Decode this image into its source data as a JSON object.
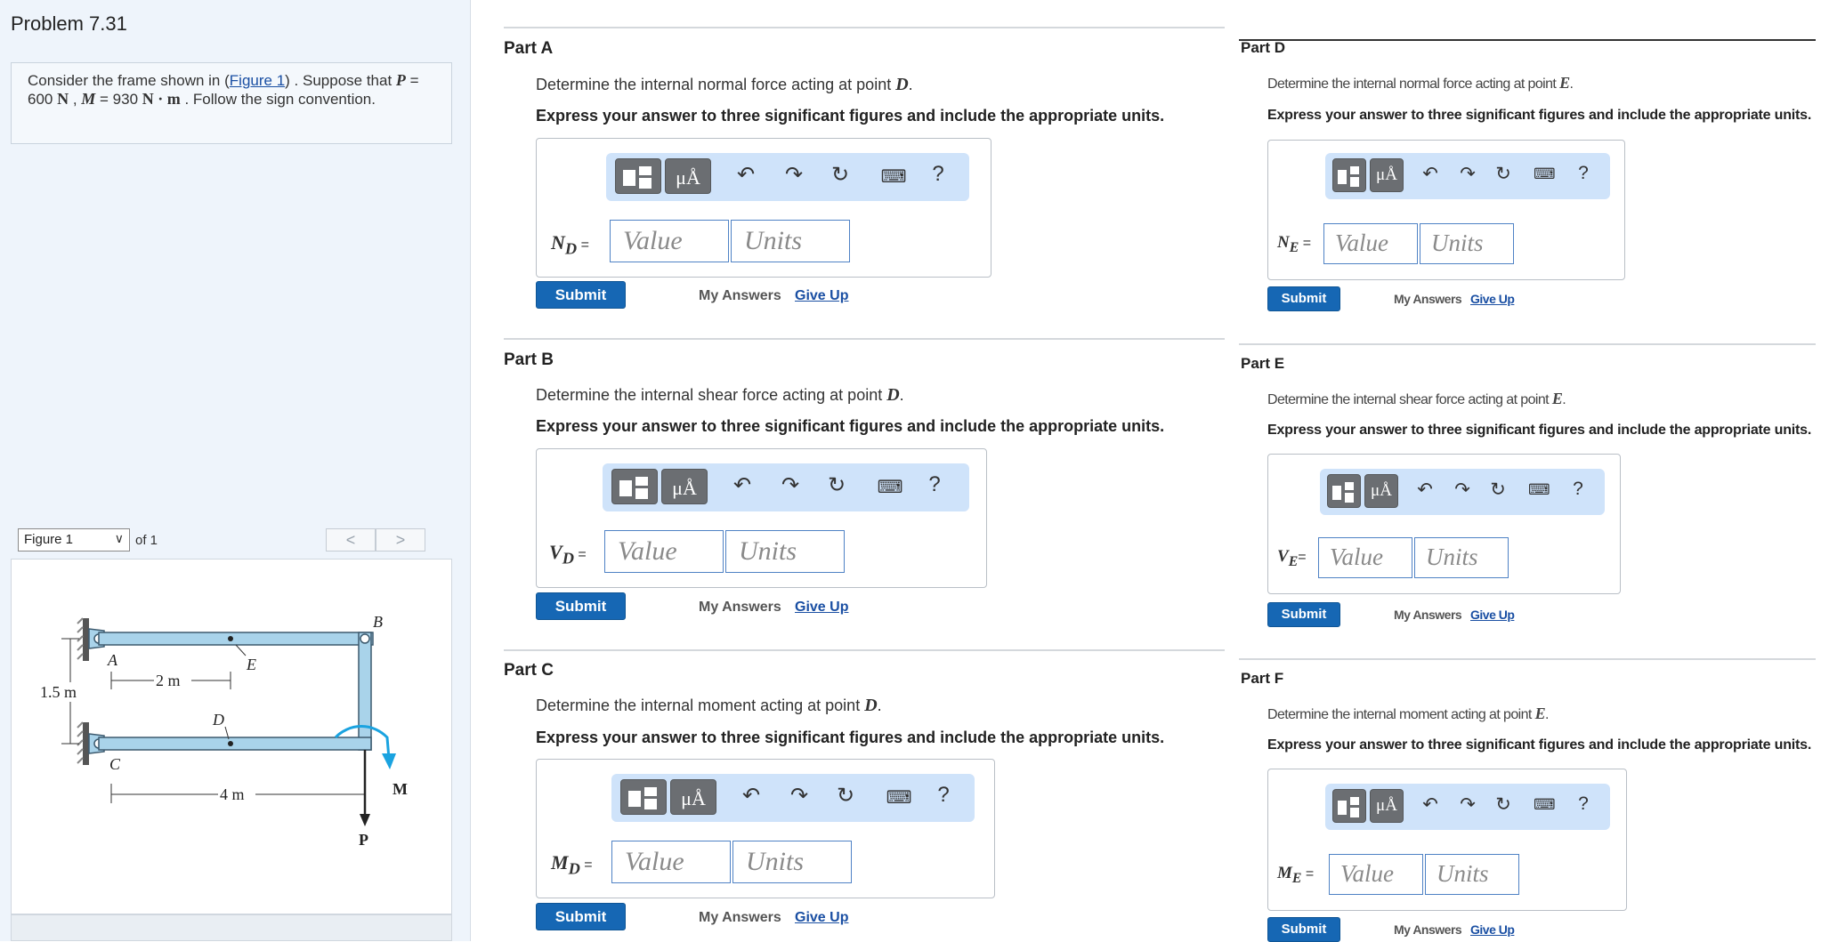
{
  "problem": {
    "title": "Problem 7.31",
    "intro": {
      "pre": "Consider the frame shown in (",
      "link": "Figure 1",
      "mid": ") . Suppose that",
      "p_var": "P",
      "p_val": " = 600  ",
      "p_unit": "N",
      "sep": " , ",
      "m_var": "M",
      "m_val": " = 930  ",
      "m_unit": "N · m",
      "post": " . Follow the sign convention."
    }
  },
  "figure": {
    "selector_value": "Figure 1",
    "of_label": "of 1",
    "prev": "<",
    "next": ">",
    "labels": {
      "A": "A",
      "B": "B",
      "C": "C",
      "D": "D",
      "E": "E",
      "M": "M",
      "P": "P",
      "dim_2m": "2 m",
      "dim_4m": "4 m",
      "dim_15m": "1.5 m"
    }
  },
  "common": {
    "instruction": "Express your answer to three significant figures and include the appropriate units.",
    "value_placeholder": "Value",
    "units_placeholder": "Units",
    "submit": "Submit",
    "my_answers": "My Answers",
    "give_up": "Give Up",
    "undo_glyph": "↶",
    "redo_glyph": "↷",
    "reset_glyph": "↻",
    "keyboard_glyph": "⌨",
    "help_glyph": "?",
    "units_glyph": "μÅ"
  },
  "parts": [
    {
      "label": "Part A",
      "text_pre": "Determine the internal normal force acting at point ",
      "point": "D",
      "text_post": ".",
      "var": "N",
      "sub": "D"
    },
    {
      "label": "Part B",
      "text_pre": "Determine the internal shear force acting at point ",
      "point": "D",
      "text_post": ".",
      "var": "V",
      "sub": "D"
    },
    {
      "label": "Part C",
      "text_pre": "Determine the internal moment acting at point ",
      "point": "D",
      "text_post": ".",
      "var": "M",
      "sub": "D"
    },
    {
      "label": "Part D",
      "text_pre": "Determine the internal normal force acting at point ",
      "point": "E",
      "text_post": ".",
      "var": "N",
      "sub": "E"
    },
    {
      "label": "Part E",
      "text_pre": "Determine the internal shear force acting at point ",
      "point": "E",
      "text_post": ".",
      "var": "V",
      "sub": "E"
    },
    {
      "label": "Part F",
      "text_pre": "Determine the internal moment acting at point ",
      "point": "E",
      "text_post": ".",
      "var": "M",
      "sub": "E"
    }
  ],
  "colors": {
    "submit": "#1667b4",
    "toolbar": "#cfe3fa",
    "frame_member": "#a9d3ea",
    "moment_arrow": "#1aa3e0"
  }
}
